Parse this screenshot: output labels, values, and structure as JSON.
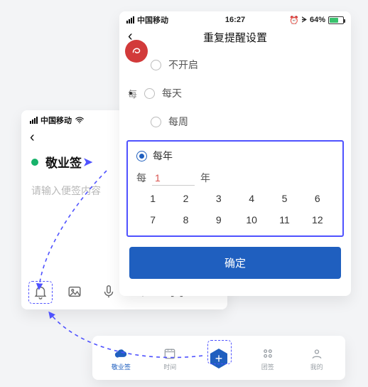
{
  "left": {
    "carrier": "中国移动",
    "title": "敬业签",
    "placeholder": "请输入便签内容"
  },
  "right": {
    "carrier": "中国移动",
    "time": "16:27",
    "battery_pct": "64%",
    "header": "重复提醒设置",
    "opt_off": "不开启",
    "opt_day": "每天",
    "opt_week": "每周",
    "opt_year": "每年",
    "every_prefix": "每",
    "interval_value": "1",
    "unit_year": "年",
    "months": [
      "1",
      "2",
      "3",
      "4",
      "5",
      "6",
      "7",
      "8",
      "9",
      "10",
      "11",
      "12"
    ],
    "confirm": "确定",
    "etc_label": "每"
  },
  "tabs": {
    "t1": "敬业签",
    "t2": "时间",
    "t4": "团签",
    "t5": "我的"
  }
}
